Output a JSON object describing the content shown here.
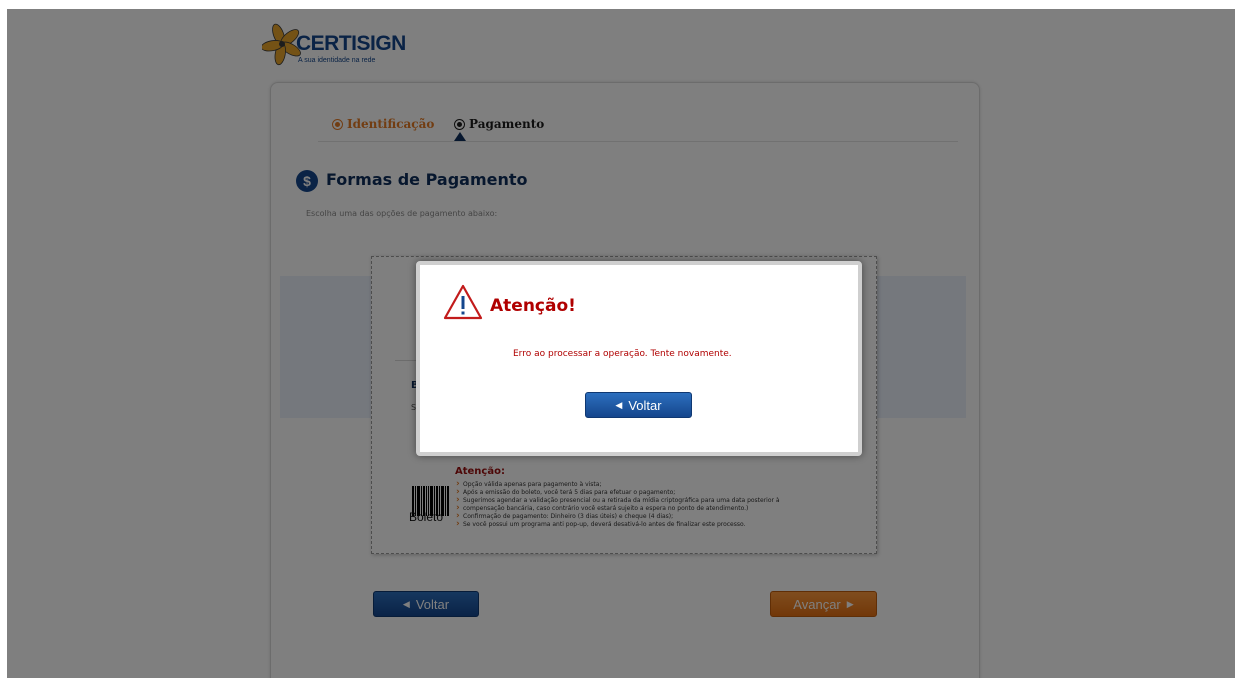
{
  "brand": {
    "name": "CERTISIGN",
    "tagline": "A sua identidade na rede"
  },
  "steps": [
    {
      "label": "Identificação",
      "state": "completed"
    },
    {
      "label": "Pagamento",
      "state": "current"
    }
  ],
  "section": {
    "icon": "dollar-icon",
    "title": "Formas de Pagamento",
    "subtitle": "Escolha uma das opções de pagamento abaixo:"
  },
  "payment_box": {
    "partial_heading": "B",
    "partial_text": "S",
    "boleto_label": "Boleto",
    "attention_title": "Atenção:",
    "notes": [
      "Opção válida apenas para pagamento à vista;",
      "Após a emissão do boleto, você terá 5 dias para efetuar o pagamento;",
      "Sugerimos agendar a validação presencial ou a retirada da mídia criptográfica para uma data posterior à",
      "compensação bancária, caso contrário você estará sujeito a espera no ponto de atendimento.)",
      "Confirmação de pagamento: Dinheiro (3 dias úteis) e cheque (4 dias);",
      "Se você possui um programa anti pop-up, deverá desativá-lo antes de finalizar este processo."
    ]
  },
  "nav": {
    "back_label": "Voltar",
    "next_label": "Avançar"
  },
  "modal": {
    "icon": "warning-triangle-icon",
    "title": "Atenção!",
    "message": "Erro ao processar a operação. Tente novamente.",
    "button_label": "Voltar"
  },
  "colors": {
    "brand_blue": "#14468c",
    "accent_orange": "#e47a24",
    "error_red": "#b00000",
    "overlay": "rgba(0,0,0,0.5)"
  }
}
